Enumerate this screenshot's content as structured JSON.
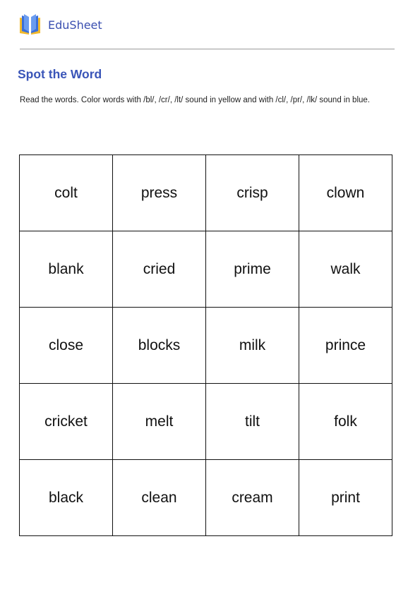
{
  "header": {
    "brand": "EduSheet",
    "logo_icon": "open-book-icon"
  },
  "worksheet": {
    "title": "Spot the Word",
    "instructions": "Read the words. Color words with /bl/, /cr/, /lt/ sound in yellow and with /cl/, /pr/, /lk/ sound in blue."
  },
  "grid": {
    "rows": [
      [
        "colt",
        "press",
        "crisp",
        "clown"
      ],
      [
        "blank",
        "cried",
        "prime",
        "walk"
      ],
      [
        "close",
        "blocks",
        "milk",
        "prince"
      ],
      [
        "cricket",
        "melt",
        "tilt",
        "folk"
      ],
      [
        "black",
        "clean",
        "cream",
        "print"
      ]
    ]
  }
}
